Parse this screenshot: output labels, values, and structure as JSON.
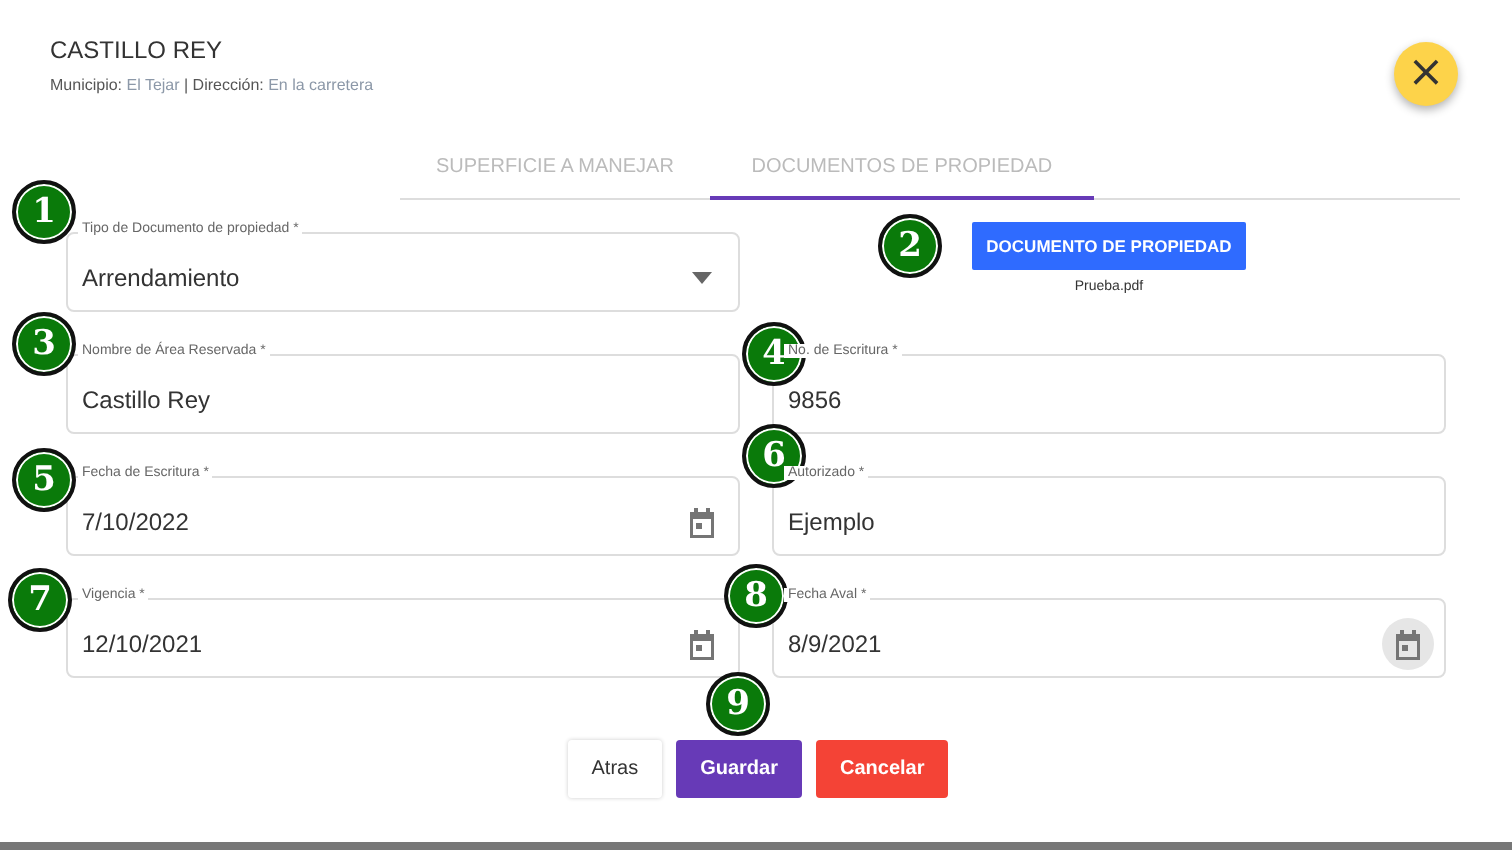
{
  "header": {
    "title": "CASTILLO REY",
    "municipio_label": "Municipio:",
    "municipio": "El Tejar",
    "separator": "|",
    "direccion_label": "Dirección:",
    "direccion": "En la carretera"
  },
  "close_button": {
    "icon": "×"
  },
  "tabs": [
    {
      "label": "SUPERFICIE A MANEJAR",
      "selected": false
    },
    {
      "label": "DOCUMENTOS DE PROPIEDAD",
      "selected": true
    }
  ],
  "fields": [
    {
      "kind": "select",
      "label": "Tipo de Documento de propiedad *",
      "value": "Arrendamiento"
    },
    {
      "kind": "upload",
      "button": "DOCUMENTO DE PROPIEDAD",
      "file": "Prueba.pdf"
    },
    {
      "kind": "text",
      "label": "Nombre de Área Reservada *",
      "value": "Castillo Rey"
    },
    {
      "kind": "text",
      "label": "No. de Escritura *",
      "value": "9856"
    },
    {
      "kind": "date",
      "label": "Fecha de Escritura *",
      "value": "7/10/2022",
      "icon_highlighted": false
    },
    {
      "kind": "text",
      "label": "Autorizado *",
      "value": "Ejemplo"
    },
    {
      "kind": "date",
      "label": "Vigencia *",
      "value": "12/10/2021",
      "icon_highlighted": false
    },
    {
      "kind": "date",
      "label": "Fecha Aval *",
      "value": "8/9/2021",
      "icon_highlighted": true
    }
  ],
  "buttons": [
    {
      "kind": "plain",
      "label": "Atras"
    },
    {
      "kind": "primary",
      "label": "Guardar"
    },
    {
      "kind": "danger",
      "label": "Cancelar"
    }
  ],
  "markers": [
    "1",
    "2",
    "3",
    "4",
    "5",
    "6",
    "7",
    "8",
    "9"
  ]
}
